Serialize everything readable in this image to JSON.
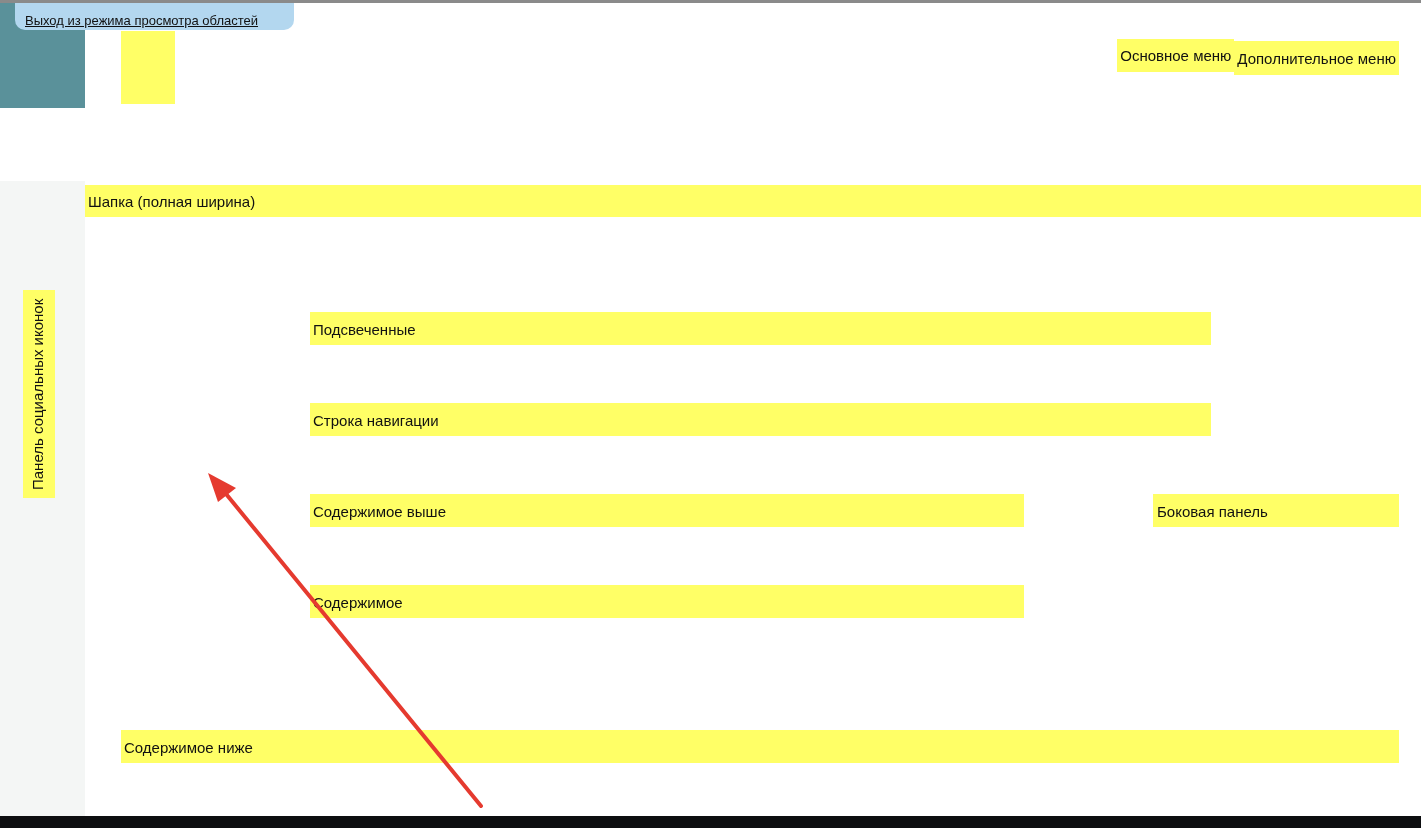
{
  "exit_link": "Выход из режима просмотра областей",
  "top_menus": [
    "Основное меню",
    "Дополнительное меню"
  ],
  "social_panel": "Панель социальных иконок",
  "header": "Шапка (полная ширина)",
  "regions": [
    {
      "label": "Подсвеченные",
      "kind": "wide"
    },
    {
      "label": "Строка навигации",
      "kind": "wide"
    },
    {
      "label": "Содержимое выше",
      "kind": "main",
      "sidebar": "Боковая панель"
    },
    {
      "label": "Содержимое",
      "kind": "main"
    }
  ],
  "bottom_region": "Содержимое ниже"
}
